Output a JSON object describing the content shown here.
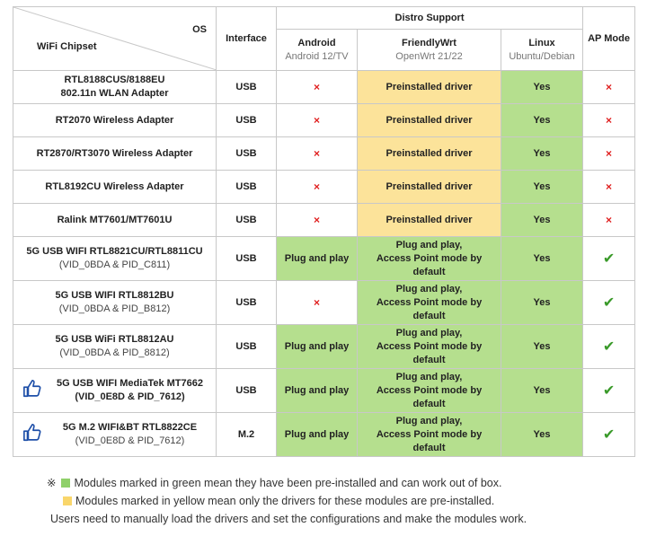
{
  "header": {
    "os_label": "OS",
    "chipset_label": "WiFi Chipset",
    "interface_label": "Interface",
    "distro_support_label": "Distro Support",
    "ap_mode_label": "AP Mode",
    "android": {
      "name": "Android",
      "version": "Android 12/TV"
    },
    "friendlywrt": {
      "name": "FriendlyWrt",
      "version": "OpenWrt 21/22"
    },
    "linux": {
      "name": "Linux",
      "version": "Ubuntu/Debian"
    }
  },
  "colors": {
    "green": "#b5df8e",
    "yellow": "#fce39a",
    "red_x": "#e02020",
    "check": "#3a9a2a"
  },
  "rows": [
    {
      "chip1": "RTL8188CUS/8188EU",
      "chip2": "802.11n WLAN Adapter",
      "chip2_style": "bold",
      "thumb": false,
      "iface": "USB",
      "android": "×",
      "android_color": "white",
      "fwrt1": "Preinstalled driver",
      "fwrt2": "",
      "fwrt_color": "yellow",
      "linux": "Yes",
      "ap": "×"
    },
    {
      "chip1": "RT2070 Wireless Adapter",
      "chip2": "",
      "chip2_style": "bold",
      "thumb": false,
      "iface": "USB",
      "android": "×",
      "android_color": "white",
      "fwrt1": "Preinstalled driver",
      "fwrt2": "",
      "fwrt_color": "yellow",
      "linux": "Yes",
      "ap": "×"
    },
    {
      "chip1": "RT2870/RT3070 Wireless Adapter",
      "chip2": "",
      "chip2_style": "bold",
      "thumb": false,
      "iface": "USB",
      "android": "×",
      "android_color": "white",
      "fwrt1": "Preinstalled driver",
      "fwrt2": "",
      "fwrt_color": "yellow",
      "linux": "Yes",
      "ap": "×"
    },
    {
      "chip1": "RTL8192CU Wireless Adapter",
      "chip2": "",
      "chip2_style": "bold",
      "thumb": false,
      "iface": "USB",
      "android": "×",
      "android_color": "white",
      "fwrt1": "Preinstalled driver",
      "fwrt2": "",
      "fwrt_color": "yellow",
      "linux": "Yes",
      "ap": "×"
    },
    {
      "chip1": "Ralink MT7601/MT7601U",
      "chip2": "",
      "chip2_style": "bold",
      "thumb": false,
      "iface": "USB",
      "android": "×",
      "android_color": "white",
      "fwrt1": "Preinstalled driver",
      "fwrt2": "",
      "fwrt_color": "yellow",
      "linux": "Yes",
      "ap": "×"
    },
    {
      "chip1": "5G USB WIFI RTL8821CU/RTL8811CU",
      "chip2": "(VID_0BDA & PID_C811)",
      "chip2_style": "muted",
      "thumb": false,
      "iface": "USB",
      "android": "Plug and play",
      "android_color": "green",
      "fwrt1": "Plug and play,",
      "fwrt2": "Access Point mode by default",
      "fwrt_color": "green",
      "linux": "Yes",
      "ap": "✔"
    },
    {
      "chip1": "5G USB WIFI RTL8812BU",
      "chip2": "(VID_0BDA & PID_B812)",
      "chip2_style": "muted",
      "thumb": false,
      "iface": "USB",
      "android": "×",
      "android_color": "white",
      "fwrt1": "Plug and play,",
      "fwrt2": "Access Point mode by default",
      "fwrt_color": "green",
      "linux": "Yes",
      "ap": "✔"
    },
    {
      "chip1": "5G USB WiFi RTL8812AU",
      "chip2": "(VID_0BDA & PID_8812)",
      "chip2_style": "muted",
      "thumb": false,
      "iface": "USB",
      "android": "Plug and play",
      "android_color": "green",
      "fwrt1": "Plug and play,",
      "fwrt2": "Access Point mode by default",
      "fwrt_color": "green",
      "linux": "Yes",
      "ap": "✔"
    },
    {
      "chip1": "5G USB WIFI MediaTek MT7662",
      "chip2": "(VID_0E8D & PID_7612)",
      "chip2_style": "bold",
      "thumb": true,
      "iface": "USB",
      "android": "Plug and play",
      "android_color": "green",
      "fwrt1": "Plug and play,",
      "fwrt2": "Access Point mode by default",
      "fwrt_color": "green",
      "linux": "Yes",
      "ap": "✔"
    },
    {
      "chip1": "5G M.2 WIFI&BT RTL8822CE",
      "chip2": "(VID_0E8D & PID_7612)",
      "chip2_style": "muted",
      "thumb": true,
      "iface": "M.2",
      "android": "Plug and play",
      "android_color": "green",
      "fwrt1": "Plug and play,",
      "fwrt2": "Access Point mode by default",
      "fwrt_color": "green",
      "linux": "Yes",
      "ap": "✔"
    }
  ],
  "notes": {
    "symbol": "※",
    "green_note": "Modules marked in green mean they have been pre-installed and can work out of box.",
    "yellow_note": "Modules marked in yellow mean only the drivers for these modules are pre-installed.",
    "extra_note": "Users need to manually load the drivers and set the configurations and make the modules work."
  }
}
